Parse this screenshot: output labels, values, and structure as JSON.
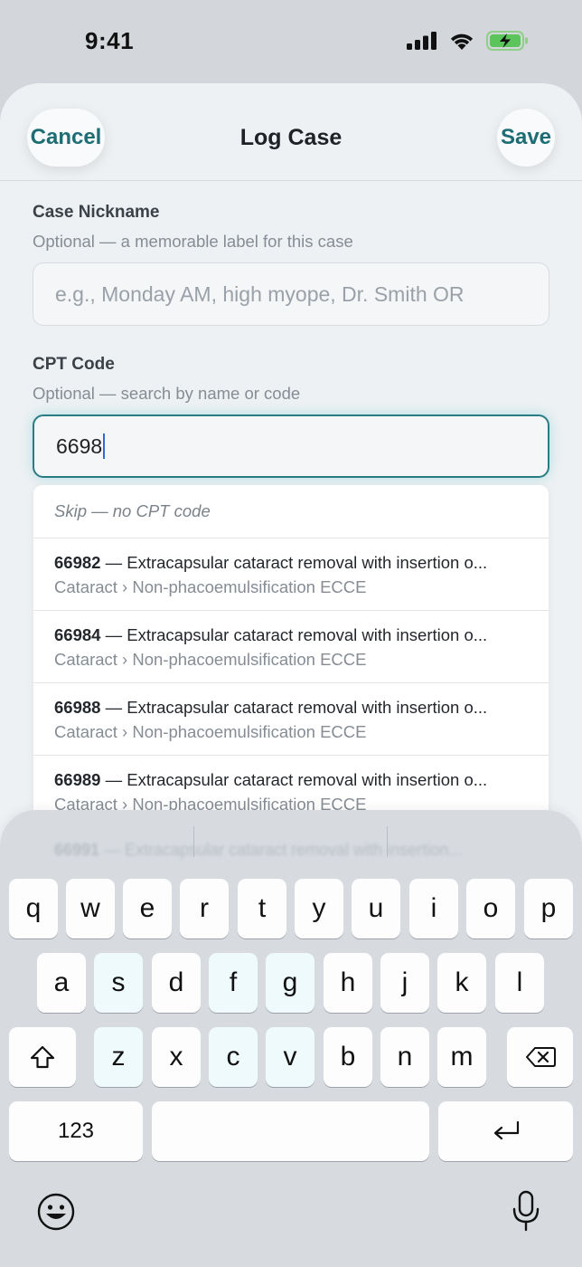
{
  "status_bar": {
    "time": "9:41"
  },
  "header": {
    "title": "Log Case",
    "cancel_label": "Cancel",
    "save_label": "Save"
  },
  "nickname": {
    "label": "Case Nickname",
    "help": "Optional — a memorable label for this case",
    "placeholder": "e.g., Monday AM, high myope, Dr. Smith OR",
    "value": ""
  },
  "cpt": {
    "label": "CPT Code",
    "help": "Optional — search by name or code",
    "value": "6698"
  },
  "dropdown": {
    "skip_label": "Skip — no CPT code",
    "options": [
      {
        "code": "66982",
        "desc": " — Extracapsular cataract removal with insertion o...",
        "category": "Cataract › Non-phacoemulsification ECCE"
      },
      {
        "code": "66984",
        "desc": " — Extracapsular cataract removal with insertion o...",
        "category": "Cataract › Non-phacoemulsification ECCE"
      },
      {
        "code": "66988",
        "desc": " — Extracapsular cataract removal with insertion o...",
        "category": "Cataract › Non-phacoemulsification ECCE"
      },
      {
        "code": "66989",
        "desc": " — Extracapsular cataract removal with insertion o...",
        "category": "Cataract › Non-phacoemulsification ECCE"
      }
    ]
  },
  "keyboard": {
    "row1": [
      "q",
      "w",
      "e",
      "r",
      "t",
      "y",
      "u",
      "i",
      "o",
      "p"
    ],
    "row2": [
      "a",
      "s",
      "d",
      "f",
      "g",
      "h",
      "j",
      "k",
      "l"
    ],
    "row3": [
      "z",
      "x",
      "c",
      "v",
      "b",
      "n",
      "m"
    ],
    "numbers_label": "123",
    "ghost_code": "66991",
    "ghost_text": "— Extracapsular cataract removal with insertion..."
  }
}
